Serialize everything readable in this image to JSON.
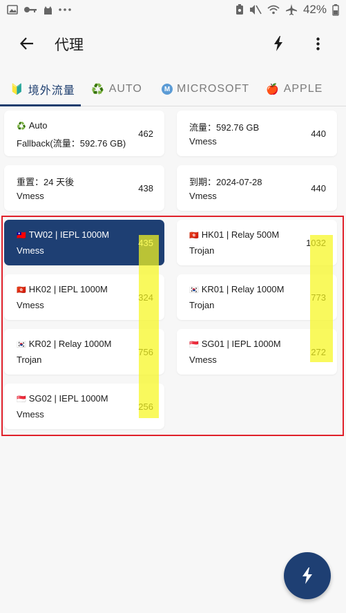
{
  "status_bar": {
    "battery": "42%"
  },
  "app_bar": {
    "title": "代理"
  },
  "tabs": [
    {
      "emoji": "🔰",
      "label": "境外流量"
    },
    {
      "emoji": "♻️",
      "label": "AUTO"
    },
    {
      "emoji": "M",
      "label": "MICROSOFT"
    },
    {
      "emoji": "🍎",
      "label": "APPLE"
    }
  ],
  "cards": [
    {
      "flag": "♻️",
      "line1": "Auto",
      "line2": "Fallback(流量：592.76 GB)",
      "num": "462"
    },
    {
      "line1": "流量：592.76 GB",
      "line2": "Vmess",
      "num": "440"
    },
    {
      "line1": "重置：24 天後",
      "line2": "Vmess",
      "num": "438"
    },
    {
      "line1": "到期：2024-07-28",
      "line2": "Vmess",
      "num": "440"
    },
    {
      "flag": "🇹🇼",
      "line1": "TW02 | IEPL 1000M",
      "line2": "Vmess",
      "num": "435",
      "selected": true
    },
    {
      "flag": "🇭🇰",
      "line1": "HK01 | Relay 500M",
      "line2": "Trojan",
      "num": "1032"
    },
    {
      "flag": "🇭🇰",
      "line1": "HK02 | IEPL 1000M",
      "line2": "Vmess",
      "num": "324"
    },
    {
      "flag": "🇰🇷",
      "line1": "KR01 | Relay 1000M",
      "line2": "Trojan",
      "num": "773"
    },
    {
      "flag": "🇰🇷",
      "line1": "KR02 | Relay 1000M",
      "line2": "Trojan",
      "num": "756"
    },
    {
      "flag": "🇸🇬",
      "line1": "SG01 | IEPL 1000M",
      "line2": "Vmess",
      "num": "272"
    },
    {
      "flag": "🇸🇬",
      "line1": "SG02 | IEPL 1000M",
      "line2": "Vmess",
      "num": "256"
    }
  ],
  "colors": {
    "accent": "#1e3f73",
    "highlight": "#f7f71e",
    "annotation_box": "#e0202a"
  }
}
